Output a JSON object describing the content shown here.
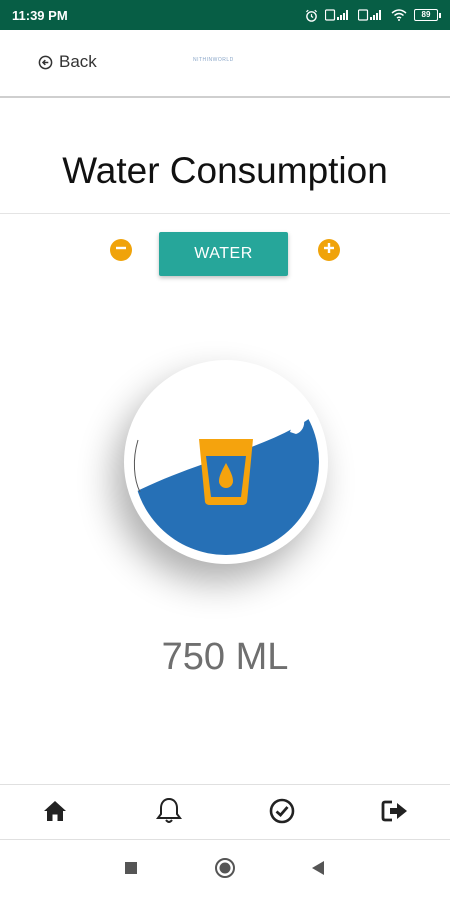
{
  "status_bar": {
    "time": "11:39 PM",
    "battery": "89",
    "icons": [
      "alarm-icon",
      "sim-1-signal-icon",
      "sim-2-signal-icon",
      "wifi-icon",
      "battery-icon"
    ]
  },
  "header": {
    "back_label": "Back",
    "logo_text": "NITHINWORLD"
  },
  "page": {
    "title": "Water Consumption"
  },
  "controls": {
    "water_label": "WATER",
    "minus_icon": "minus-circle-icon",
    "plus_icon": "plus-circle-icon"
  },
  "glass": {
    "icon": "water-glass-icon",
    "fill_level": 0.45
  },
  "amount": {
    "value": "750 ML"
  },
  "bottom_nav": {
    "items": [
      "home-icon",
      "bell-icon",
      "check-circle-icon",
      "logout-icon"
    ]
  },
  "system_nav": {
    "items": [
      "recents-icon",
      "home-circle-icon",
      "back-triangle-icon"
    ]
  },
  "colors": {
    "status_bar": "#075e45",
    "accent_orange": "#f0a30a",
    "water_button": "#26a69a",
    "water_blue": "#2670b6"
  }
}
